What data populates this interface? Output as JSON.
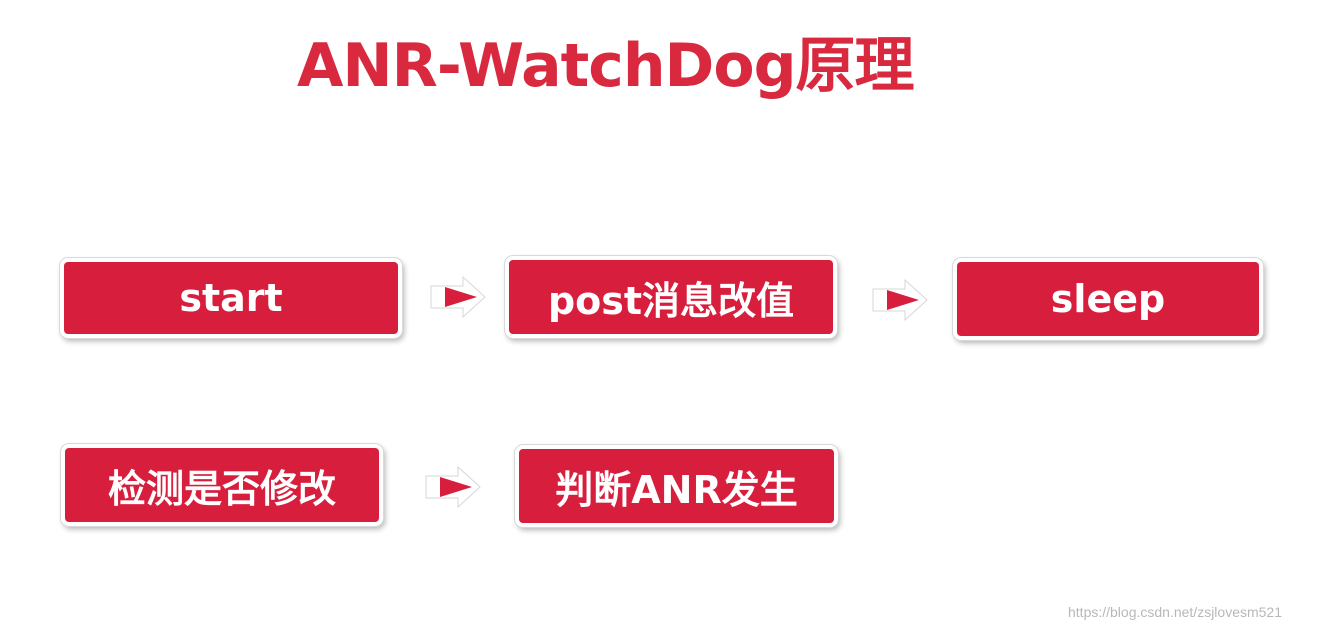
{
  "title": "ANR-WatchDog原理",
  "flow": {
    "row1": [
      "start",
      "post消息改值",
      "sleep"
    ],
    "row2": [
      "检测是否修改",
      "判断ANR发生"
    ]
  },
  "arrow_icon": "right-triangle-arrow-icon",
  "colors": {
    "title": "#d8293f",
    "box_fill": "#d81e3d",
    "box_text": "#ffffff",
    "box_border": "#ffffff"
  },
  "watermark": "https://blog.csdn.net/zsjlovesm521"
}
